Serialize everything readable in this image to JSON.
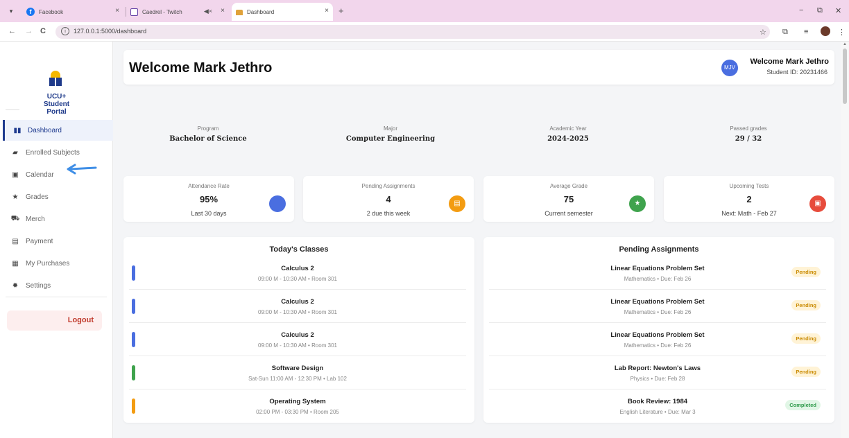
{
  "browser": {
    "tabs": [
      {
        "title": "Facebook",
        "close": "×"
      },
      {
        "title": "Caedrel - Twitch",
        "close": "×"
      },
      {
        "title": "Dashboard",
        "close": "×"
      }
    ],
    "new_tab": "+",
    "url": "127.0.0.1:5000/dashboard",
    "nav": {
      "back": "←",
      "forward": "→",
      "reload": "C"
    },
    "window": {
      "minimize": "−",
      "maximize": "⧉",
      "close": "✕"
    }
  },
  "sidebar": {
    "brand": "UCU+\nStudent\nPortal",
    "items": [
      {
        "label": "Dashboard",
        "icon": "dashboard-icon",
        "glyph": "▮▮"
      },
      {
        "label": "Enrolled Subjects",
        "icon": "book-icon",
        "glyph": "▰"
      },
      {
        "label": "Calendar",
        "icon": "calendar-icon",
        "glyph": "▣"
      },
      {
        "label": "Grades",
        "icon": "star-icon",
        "glyph": "★"
      },
      {
        "label": "Merch",
        "icon": "cart-icon",
        "glyph": "⛟"
      },
      {
        "label": "Payment",
        "icon": "card-icon",
        "glyph": "▤"
      },
      {
        "label": "My Purchases",
        "icon": "receipt-icon",
        "glyph": "▦"
      },
      {
        "label": "Settings",
        "icon": "gear-icon",
        "glyph": "✹"
      }
    ],
    "logout": "Logout"
  },
  "header": {
    "title": "Welcome Mark Jethro",
    "avatar": "MJV",
    "user_name": "Welcome Mark Jethro",
    "student_id": "Student ID: 20231466"
  },
  "info": [
    {
      "label": "Program",
      "value": "Bachelor of Science"
    },
    {
      "label": "Major",
      "value": "Computer Engineering"
    },
    {
      "label": "Academic Year",
      "value": "2024-2025"
    },
    {
      "label": "Passed grades",
      "value": "29 / 32"
    }
  ],
  "stats": [
    {
      "label": "Attendance Rate",
      "value": "95%",
      "sub": "Last 30 days",
      "color": "#4a6ee0",
      "glyph": ""
    },
    {
      "label": "Pending Assignments",
      "value": "4",
      "sub": "2 due this week",
      "color": "#f39c12",
      "glyph": "▤"
    },
    {
      "label": "Average Grade",
      "value": "75",
      "sub": "Current semester",
      "color": "#3fa34d",
      "glyph": "★"
    },
    {
      "label": "Upcoming Tests",
      "value": "2",
      "sub": "Next: Math - Feb 27",
      "color": "#e74c3c",
      "glyph": "▣"
    }
  ],
  "todays_classes": {
    "title": "Today's Classes",
    "rows": [
      {
        "title": "Calculus 2",
        "sub": "09:00 M - 10:30 AM • Room 301",
        "color": "#4a6ee0"
      },
      {
        "title": "Calculus 2",
        "sub": "09:00 M - 10:30 AM • Room 301",
        "color": "#4a6ee0"
      },
      {
        "title": "Calculus 2",
        "sub": "09:00 M - 10:30 AM • Room 301",
        "color": "#4a6ee0"
      },
      {
        "title": "Software Design",
        "sub": "Sat-Sun 11:00 AM - 12:30 PM • Lab 102",
        "color": "#3fa34d"
      },
      {
        "title": "Operating System",
        "sub": "02:00 PM - 03:30 PM • Room 205",
        "color": "#f39c12"
      }
    ]
  },
  "pending_assignments": {
    "title": "Pending Assignments",
    "rows": [
      {
        "title": "Linear Equations Problem Set",
        "sub": "Mathematics • Due: Feb 26",
        "status": "Pending"
      },
      {
        "title": "Linear Equations Problem Set",
        "sub": "Mathematics • Due: Feb 26",
        "status": "Pending"
      },
      {
        "title": "Linear Equations Problem Set",
        "sub": "Mathematics • Due: Feb 26",
        "status": "Pending"
      },
      {
        "title": "Lab Report: Newton's Laws",
        "sub": "Physics • Due: Feb 28",
        "status": "Pending"
      },
      {
        "title": "Book Review: 1984",
        "sub": "English Literature • Due: Mar 3",
        "status": "Completed"
      }
    ]
  }
}
